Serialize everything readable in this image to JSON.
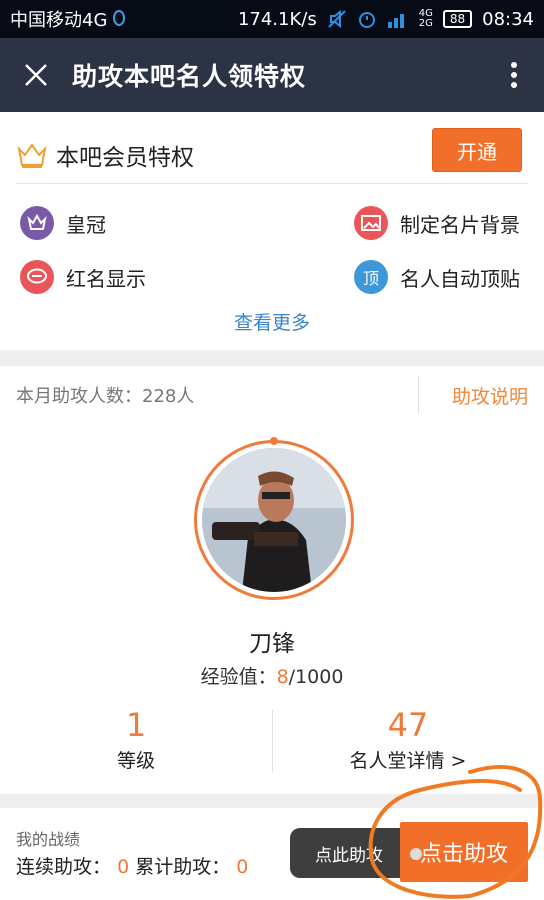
{
  "status_bar": {
    "carrier": "中国移动4G",
    "speed": "174.1K/s",
    "network_small": "4G",
    "network_small2": "2G",
    "battery": "88",
    "time": "08:34"
  },
  "header": {
    "title": "助攻本吧名人领特权"
  },
  "member": {
    "title": "本吧会员特权",
    "open_label": "开通",
    "privileges": [
      {
        "label": "皇冠",
        "icon": "crown-icon",
        "color": "#7a5aa8"
      },
      {
        "label": "制定名片背景",
        "icon": "picture-icon",
        "color": "#ea5559"
      },
      {
        "label": "红名显示",
        "icon": "chat-bubble-icon",
        "color": "#ea5559"
      },
      {
        "label": "名人自动顶贴",
        "icon": "ding-icon",
        "color": "#3e97d8",
        "glyph": "顶"
      }
    ],
    "see_more": "查看更多"
  },
  "assist": {
    "count_label": "本月助攻人数：228人",
    "explain_label": "助攻说明",
    "name": "刀锋",
    "exp_label": "经验值：",
    "exp_current": "8",
    "exp_total": "/1000",
    "level_value": "1",
    "level_label": "等级",
    "fame_value": "47",
    "fame_label": "名人堂详情 >"
  },
  "bottom": {
    "record_title": "我的战绩",
    "streak_label": "连续助攻：",
    "streak_value": "0",
    "total_label": "累计助攻：",
    "total_value": "0",
    "tip_label": "点此助攻",
    "assist_button": "点击助攻"
  },
  "colors": {
    "accent": "#f26f2a",
    "header_bg": "#2b3345",
    "link": "#3a84c8"
  }
}
